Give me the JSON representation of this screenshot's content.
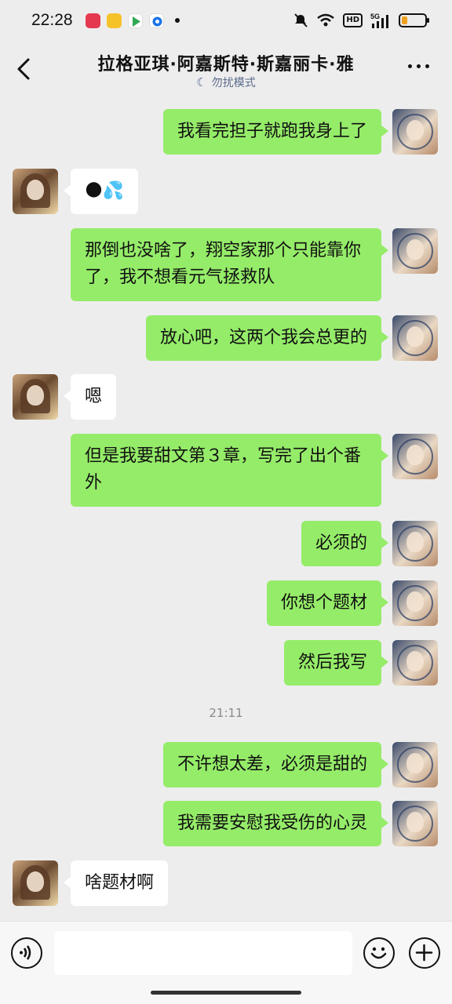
{
  "status_bar": {
    "time": "22:28",
    "network": "5G",
    "hd": "HD",
    "battery_level": 0.25
  },
  "header": {
    "title": "拉格亚琪·阿嘉斯特·斯嘉丽卡·雅",
    "subtitle": "勿扰模式"
  },
  "messages": [
    {
      "from": "self",
      "text": "我看完担子就跑我身上了"
    },
    {
      "from": "other",
      "text": "🌑💦"
    },
    {
      "from": "self",
      "text": "那倒也没啥了，翔空家那个只能靠你了，我不想看元气拯救队"
    },
    {
      "from": "self",
      "text": "放心吧，这两个我会总更的"
    },
    {
      "from": "other",
      "text": "嗯"
    },
    {
      "from": "self",
      "text": "但是我要甜文第３章，写完了出个番外"
    },
    {
      "from": "self",
      "text": "必须的"
    },
    {
      "from": "self",
      "text": "你想个题材"
    },
    {
      "from": "self",
      "text": "然后我写"
    },
    {
      "from": "self",
      "text": "不许想太差，必须是甜的"
    },
    {
      "from": "self",
      "text": "我需要安慰我受伤的心灵"
    },
    {
      "from": "other",
      "text": "啥题材啊"
    }
  ],
  "timestamp": "21:11",
  "input": {
    "value": "",
    "placeholder": ""
  },
  "colors": {
    "self_bubble": "#95ec69",
    "other_bubble": "#ffffff",
    "background": "#ededed"
  }
}
